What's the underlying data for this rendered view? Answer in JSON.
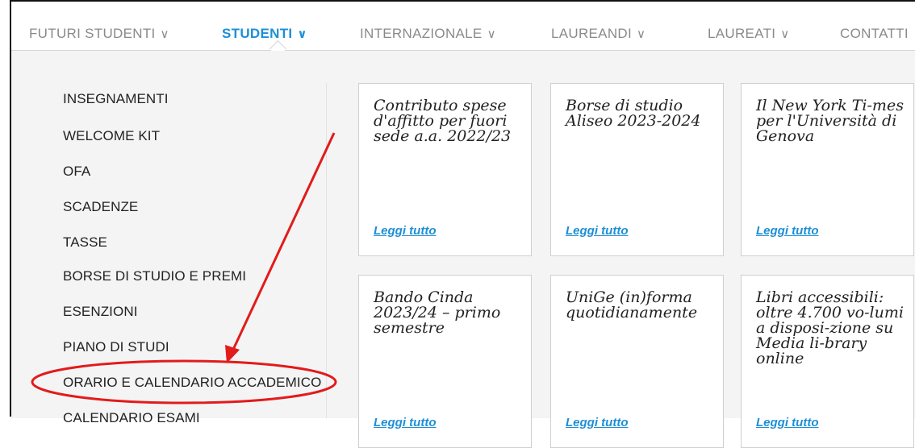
{
  "nav": {
    "items": [
      {
        "label": "FUTURI STUDENTI",
        "chevron": "∨"
      },
      {
        "label": "STUDENTI",
        "chevron": "∨"
      },
      {
        "label": "INTERNAZIONALE",
        "chevron": "∨"
      },
      {
        "label": "LAUREANDI",
        "chevron": "∨"
      },
      {
        "label": "LAUREATI",
        "chevron": "∨"
      },
      {
        "label": "CONTATTI",
        "chevron": "∨"
      }
    ],
    "active": "STUDENTI"
  },
  "menu": {
    "items": [
      "INSEGNAMENTI",
      "WELCOME KIT",
      "OFA",
      "SCADENZE",
      "TASSE",
      "BORSE DI STUDIO E PREMI",
      "ESENZIONI",
      "PIANO DI STUDI",
      "ORARIO E CALENDARIO ACCADEMICO",
      "CALENDARIO ESAMI"
    ],
    "highlighted": "ORARIO E CALENDARIO ACCADEMICO"
  },
  "cards": [
    {
      "title": "Contributo spese d'affitto per fuori sede a.a. 2022/23",
      "link": "Leggi tutto"
    },
    {
      "title": "Borse di studio Aliseo 2023-2024",
      "link": "Leggi tutto"
    },
    {
      "title": "Il New York Ti-mes per l'Università di Genova",
      "link": "Leggi tutto"
    },
    {
      "title": "Bando Cinda 2023/24 – primo semestre",
      "link": "Leggi tutto"
    },
    {
      "title": "UniGe (in)forma quotidianamente",
      "link": "Leggi tutto"
    },
    {
      "title": "Libri accessibili: oltre 4.700 vo-lumi a disposi-zione su Media li-brary online",
      "link": "Leggi tutto"
    }
  ],
  "colors": {
    "accent": "#1c8fd7",
    "annotation": "#e21b1b",
    "menu_bg": "#f4f4f4"
  }
}
